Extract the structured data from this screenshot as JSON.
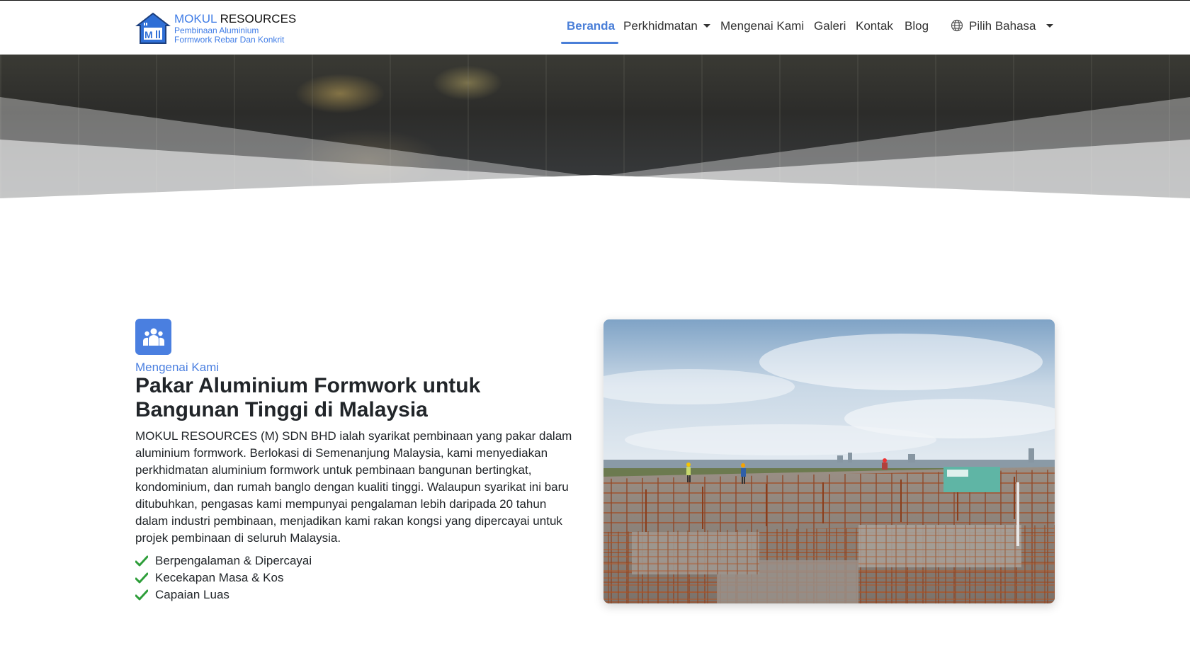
{
  "brand": {
    "name_part1": "MOKUL",
    "name_part2": "RESOURCES",
    "tagline_line1": "Pembinaan Aluminium",
    "tagline_line2": "Formwork Rebar Dan Konkrit",
    "logo_icon": "house-logo-icon"
  },
  "nav": {
    "items": [
      {
        "label": "Beranda",
        "active": true
      },
      {
        "label": "Perkhidmatan",
        "dropdown": true
      },
      {
        "label": "Mengenai Kami"
      },
      {
        "label": "Galeri"
      },
      {
        "label": "Kontak"
      },
      {
        "label": "Blog"
      }
    ],
    "language_label": "Pilih Bahasa",
    "language_icon": "globe-icon"
  },
  "about": {
    "icon": "users-icon",
    "eyebrow": "Mengenai Kami",
    "headline": "Pakar Aluminium Formwork untuk Bangunan Tinggi di Malaysia",
    "body": "MOKUL RESOURCES (M) SDN BHD ialah syarikat pembinaan yang pakar dalam aluminium formwork. Berlokasi di Semenanjung Malaysia, kami menyediakan perkhidmatan aluminium formwork untuk pembinaan bangunan bertingkat, kondominium, dan rumah banglo dengan kualiti tinggi. Walaupun syarikat ini baru ditubuhkan, pengasas kami mempunyai pengalaman lebih daripada 20 tahun dalam industri pembinaan, menjadikan kami rakan kongsi yang dipercayai untuk projek pembinaan di seluruh Malaysia.",
    "features": [
      "Berpengalaman & Dipercayai",
      "Kecekapan Masa & Kos",
      "Capaian Luas"
    ],
    "check_icon": "check-icon"
  },
  "colors": {
    "accent": "#4a7fe0",
    "check_green": "#2e9e3a",
    "text": "#212529"
  }
}
